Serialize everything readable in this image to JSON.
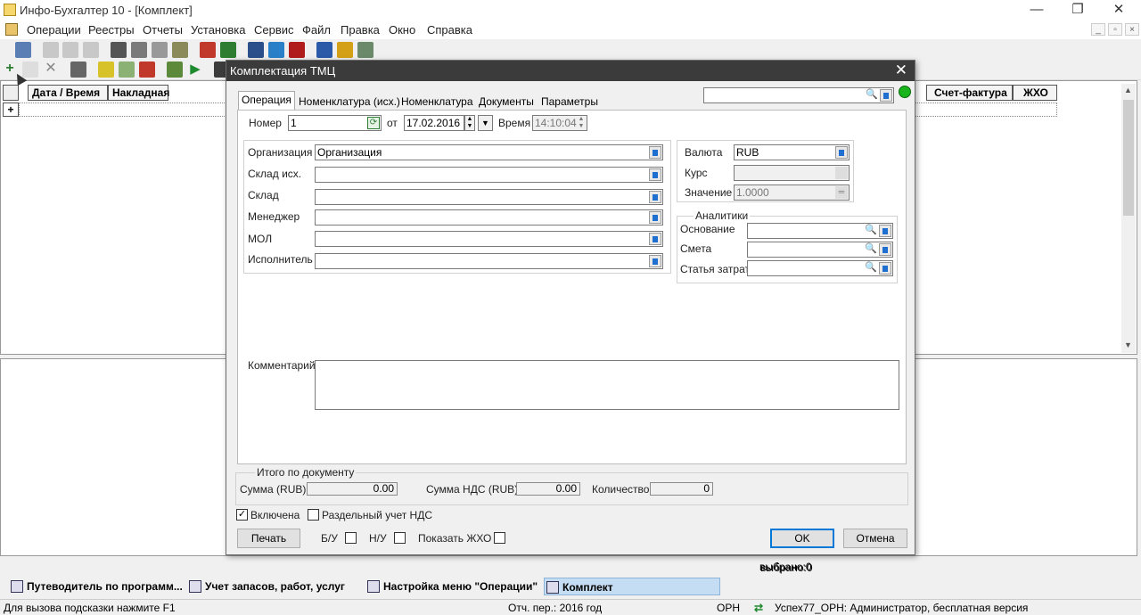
{
  "window": {
    "title": "Инфо-Бухгалтер 10 - [Комплект]",
    "min": "—",
    "max": "❐",
    "close": "✕"
  },
  "menu": [
    "Операции",
    "Реестры",
    "Отчеты",
    "Установка",
    "Сервис",
    "Файл",
    "Правка",
    "Окно",
    "Справка"
  ],
  "grid": {
    "headers": [
      "Дата / Время",
      "Накладная",
      "Счет-фактура",
      "ЖХО"
    ],
    "add": "+"
  },
  "dialog": {
    "title": "Комплектация ТМЦ",
    "close": "✕",
    "tabs": [
      "Операция",
      "Номенклатура (исх.)",
      "Номенклатура",
      "Документы",
      "Параметры"
    ],
    "number_label": "Номер",
    "number_value": "1",
    "from_label": "от",
    "date_value": "17.02.2016",
    "time_label": "Время",
    "time_value": "14:10:04",
    "org_label": "Организация",
    "org_value": "Организация",
    "sklad_isx_label": "Склад исх.",
    "sklad_label": "Склад",
    "manager_label": "Менеджер",
    "mol_label": "МОЛ",
    "executor_label": "Исполнитель",
    "currency_label": "Валюта",
    "currency_value": "RUB",
    "rate_label": "Курс",
    "value_label": "Значение",
    "value_value": "1.0000",
    "analytics_label": "Аналитики",
    "basis_label": "Основание",
    "estimate_label": "Смета",
    "cost_label": "Статья затрат",
    "comment_label": "Комментарий",
    "totals_label": "Итого по документу",
    "sum_label": "Сумма (RUB)",
    "sum_value": "0.00",
    "vat_label": "Сумма НДС (RUB)",
    "vat_value": "0.00",
    "qty_label": "Количество",
    "qty_value": "0",
    "included_label": "Включена",
    "separate_vat_label": "Раздельный учет НДС",
    "print_label": "Печать",
    "bu_label": "Б/У",
    "nu_label": "Н/У",
    "show_zho_label": "Показать ЖХО",
    "ok_label": "OK",
    "cancel_label": "Отмена",
    "check_mark": "✓"
  },
  "selected": "выбрано:0",
  "tasks": [
    "Путеводитель по программ...",
    "Учет запасов, работ, услуг",
    "Настройка меню \"Операции\"",
    "Комплект"
  ],
  "status": {
    "hint": "Для вызова подсказки нажмите F1",
    "period": "Отч. пер.: 2016 год",
    "org": "ОРН",
    "user": "Успех77_ОРН: Администратор, бесплатная версия"
  }
}
